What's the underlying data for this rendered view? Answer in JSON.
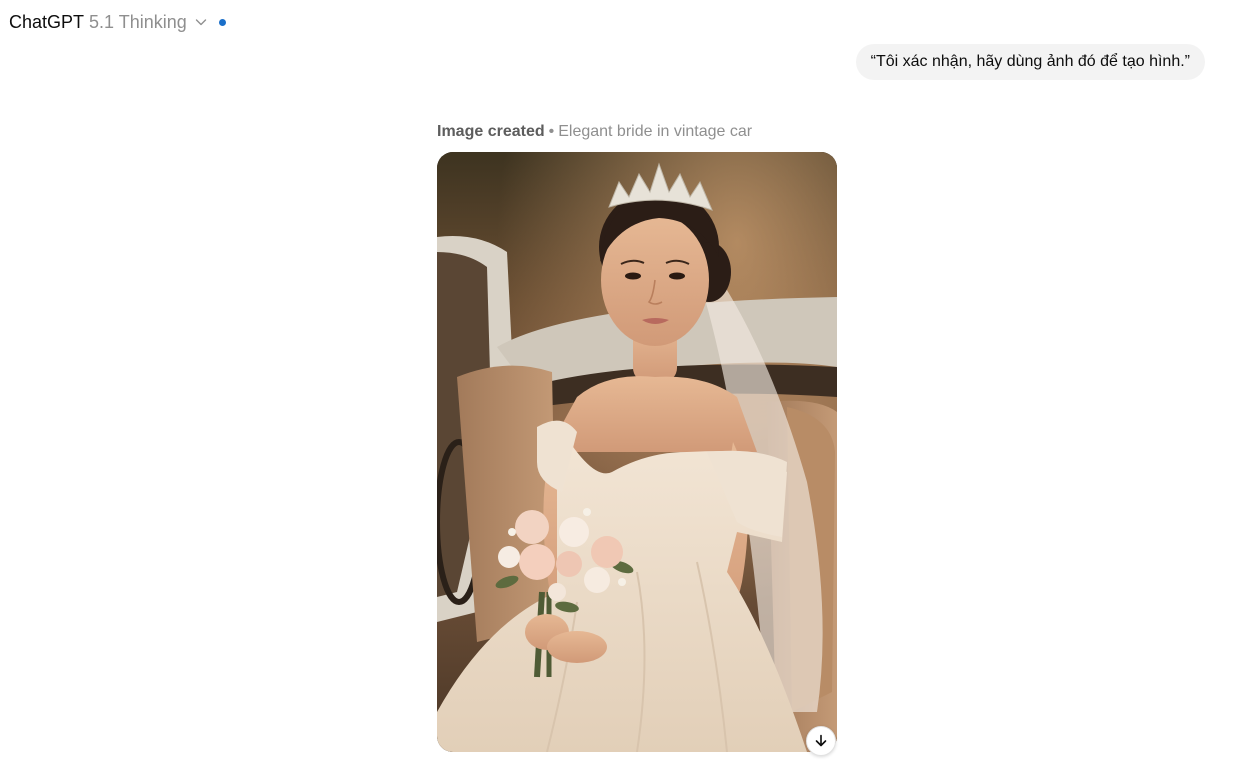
{
  "header": {
    "app_name": "ChatGPT",
    "model_name": "5.1 Thinking",
    "dropdown_icon": "chevron-down-icon",
    "status_dot_color": "#1a6fc9"
  },
  "conversation": {
    "user_message": "“Tôi xác nhận, hãy dùng ảnh đó để tạo hình.”",
    "assistant_image": {
      "status_label": "Image created",
      "separator": "•",
      "title": "Elegant bride in vintage car",
      "download_icon": "arrow-down-icon"
    }
  },
  "colors": {
    "bubble_background": "#f3f3f3",
    "muted_text": "#8f8f8f"
  }
}
